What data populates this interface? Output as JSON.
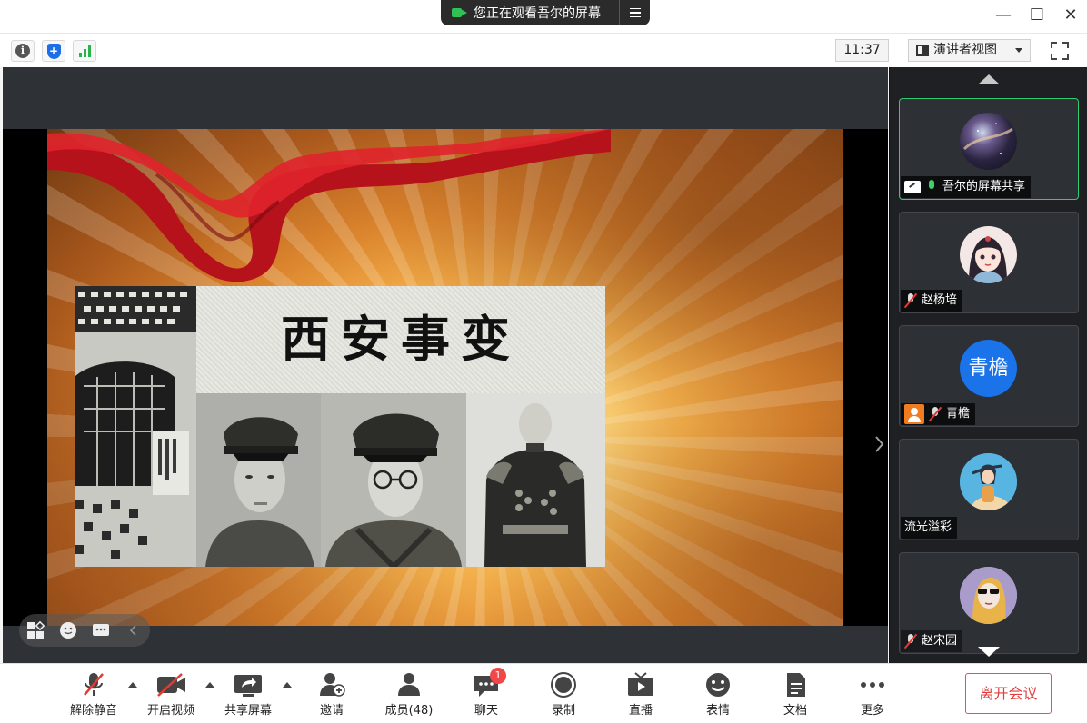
{
  "window": {
    "share_banner": "您正在观看吾尔的屏幕",
    "minimize": "—",
    "maximize": "☐",
    "close": "✕"
  },
  "infobar": {
    "clock": "11:37",
    "view_mode": "演讲者视图"
  },
  "slide": {
    "title": "西安事变"
  },
  "participants": [
    {
      "name": "吾尔的屏幕共享",
      "mic": "on",
      "sharing": true,
      "active": true,
      "avatar": "galaxy-avatar"
    },
    {
      "name": "赵杨培",
      "mic": "muted",
      "avatar": "anime-girl-avatar"
    },
    {
      "name": "青檐",
      "mic": "muted",
      "avatar_text": "青檐",
      "avatar_color": "#1a73e8",
      "video_off": true
    },
    {
      "name": "流光溢彩",
      "mic": "none",
      "avatar": "illustration-avatar"
    },
    {
      "name": "赵宋园",
      "mic": "muted",
      "avatar": "cartoon-avatar"
    }
  ],
  "toolbar": {
    "unmute": "解除静音",
    "video": "开启视频",
    "share": "共享屏幕",
    "invite": "邀请",
    "members": "成员(48)",
    "chat": "聊天",
    "chat_badge": "1",
    "record": "录制",
    "live": "直播",
    "emoji": "表情",
    "docs": "文档",
    "more": "更多",
    "leave": "离开会议"
  },
  "colors": {
    "accent_green": "#2ecc71",
    "leave_red": "#e03d3d",
    "avatar_blue": "#1a73e8"
  }
}
